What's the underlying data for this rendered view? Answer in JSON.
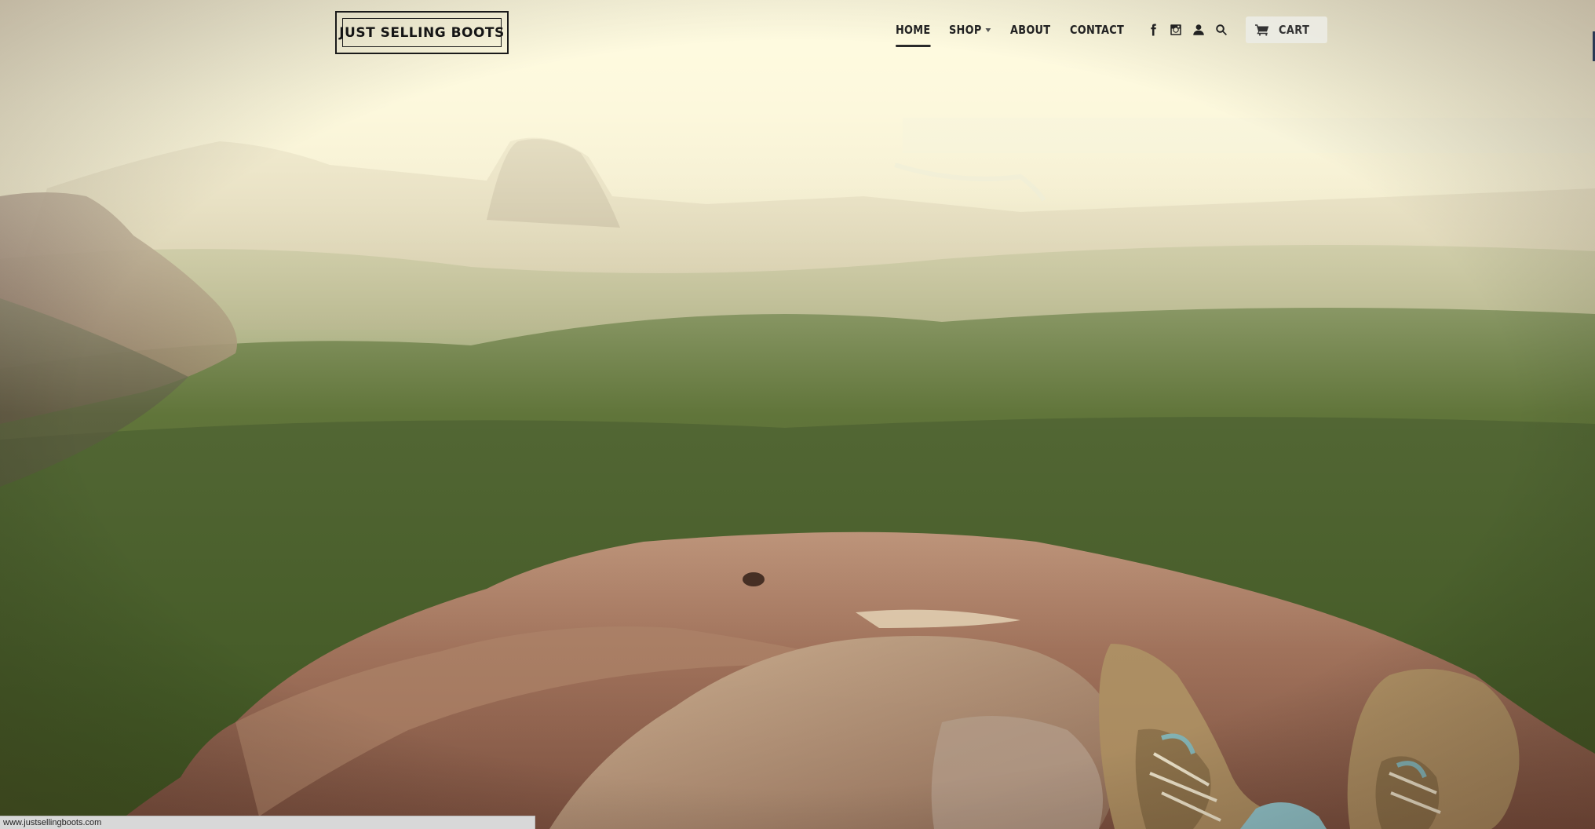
{
  "header": {
    "logo_text": "JUST SELLING BOOTS",
    "nav": {
      "home": "HOME",
      "shop": "SHOP",
      "about": "ABOUT",
      "contact": "CONTACT"
    },
    "icons": [
      "facebook-icon",
      "instagram-icon",
      "account-icon",
      "search-icon"
    ],
    "cart_label": "CART"
  },
  "status_bar": {
    "url": "www.justsellingboots.com"
  },
  "colors": {
    "nav_text": "#222222",
    "cart_bg": "#ebebe4",
    "sky_haze": "#f6f1d4"
  }
}
